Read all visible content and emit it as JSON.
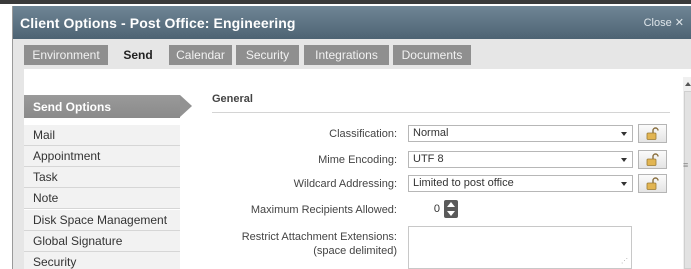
{
  "window": {
    "title": "Client Options - Post Office: Engineering",
    "close_label": "Close"
  },
  "tabs": [
    {
      "label": "Environment",
      "active": false
    },
    {
      "label": "Send",
      "active": true
    },
    {
      "label": "Calendar",
      "active": false
    },
    {
      "label": "Security",
      "active": false
    },
    {
      "label": "Integrations",
      "active": false
    },
    {
      "label": "Documents",
      "active": false
    }
  ],
  "sidebar": {
    "header": "Send Options",
    "items": [
      "Mail",
      "Appointment",
      "Task",
      "Note",
      "Disk Space Management",
      "Global Signature",
      "Security"
    ]
  },
  "content": {
    "group_title": "General",
    "fields": {
      "classification": {
        "label": "Classification:",
        "value": "Normal"
      },
      "mime_encoding": {
        "label": "Mime Encoding:",
        "value": "UTF 8"
      },
      "wildcard": {
        "label": "Wildcard Addressing:",
        "value": "Limited to post office"
      },
      "max_recipients": {
        "label": "Maximum Recipients Allowed:",
        "value": "0"
      },
      "restrict_ext": {
        "label_line1": "Restrict Attachment Extensions:",
        "label_line2": "(space delimited)",
        "value": ""
      }
    }
  },
  "colors": {
    "titlebar": "#5b7181",
    "tab_inactive": "#8f8f8f",
    "sidebar_header": "#929292"
  }
}
